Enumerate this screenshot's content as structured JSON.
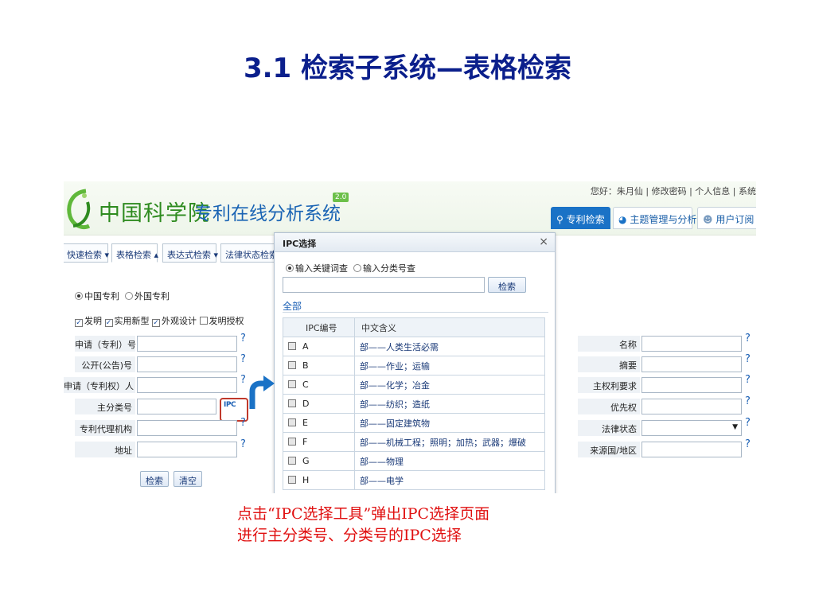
{
  "slide": {
    "title": "3.1 检索子系统—表格检索",
    "caption_line1": "点击“IPC选择工具”弹出IPC选择页面",
    "caption_line2": "进行主分类号、分类号的IPC选择"
  },
  "header": {
    "brand_cas": "中国科学院",
    "brand_system": "专利在线分析系统",
    "version": "2.0",
    "user_links": "您好：朱月仙 | 修改密码 | 个人信息 | 系统",
    "tabs": [
      "专利检索",
      "主题管理与分析",
      "用户订阅"
    ]
  },
  "search_tabs": [
    "快速检索 ▾",
    "表格检索 ▴",
    "表达式检索 ▾",
    "法律状态检索"
  ],
  "form": {
    "scope_options": [
      "中国专利",
      "外国专利"
    ],
    "type_options": [
      "发明",
      "实用新型",
      "外观设计",
      "发明授权"
    ],
    "fields_left": [
      "申请（专利）号",
      "公开(公告)号",
      "申请（专利权）人",
      "主分类号",
      "专利代理机构",
      "地址"
    ],
    "fields_right": [
      "名称",
      "摘要",
      "主权利要求",
      "优先权",
      "法律状态",
      "来源国/地区"
    ],
    "help_mark": "?",
    "ipc_tool": "IPC",
    "search_button": "检索",
    "clear_button": "清空"
  },
  "dialog": {
    "title": "IPC选择",
    "close": "×",
    "radio_keyword": "输入关键词查",
    "radio_code": "输入分类号查",
    "search_button": "检索",
    "all_link": "全部",
    "col_code": "IPC编号",
    "col_meaning": "中文含义",
    "rows": [
      {
        "code": "A",
        "meaning": "部——人类生活必需"
      },
      {
        "code": "B",
        "meaning": "部——作业；运输"
      },
      {
        "code": "C",
        "meaning": "部——化学；冶金"
      },
      {
        "code": "D",
        "meaning": "部——纺织；造纸"
      },
      {
        "code": "E",
        "meaning": "部——固定建筑物"
      },
      {
        "code": "F",
        "meaning": "部——机械工程；照明；加热；武器；爆破"
      },
      {
        "code": "G",
        "meaning": "部——物理"
      },
      {
        "code": "H",
        "meaning": "部——电学"
      }
    ]
  },
  "colors": {
    "title": "#0b1f8c",
    "caption": "#e01010",
    "brand_green": "#2e8b1f",
    "brand_blue": "#1a64b4",
    "highlight": "#c0392b",
    "arrow": "#1a72c6"
  }
}
